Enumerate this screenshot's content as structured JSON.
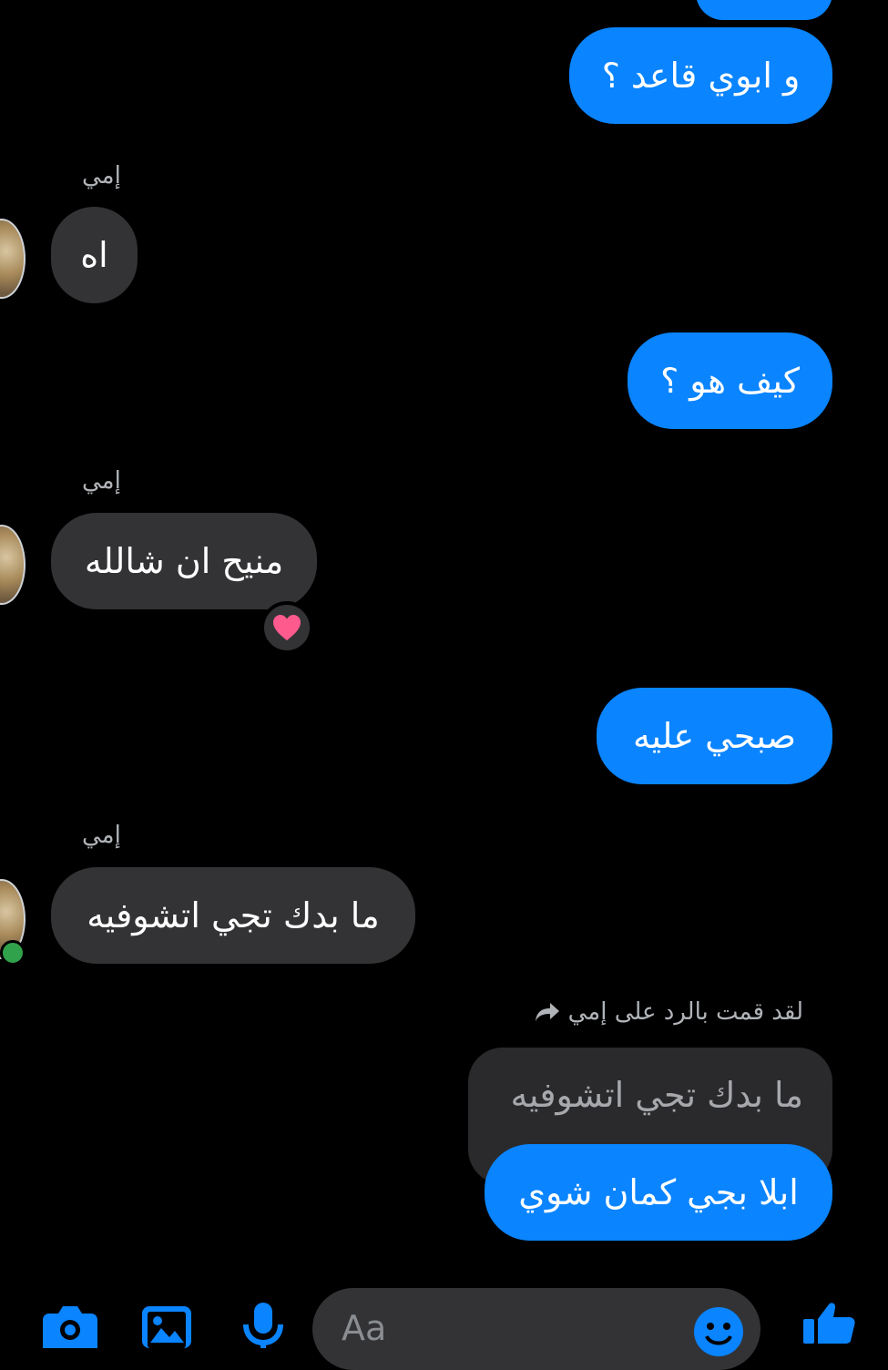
{
  "thread": {
    "sender_name": "إمي",
    "messages": [
      {
        "from": "me",
        "text": "و ابوي قاعد ؟"
      },
      {
        "from": "them",
        "text": "اه"
      },
      {
        "from": "me",
        "text": "كيف هو ؟"
      },
      {
        "from": "them",
        "text": "منيح ان شالله",
        "reaction": "pink-heart-icon"
      },
      {
        "from": "me",
        "text": "صبحي عليه"
      },
      {
        "from": "them",
        "text": "ما بدك تجي اتشوفيه"
      },
      {
        "from": "me",
        "text": "ابلا بجي كمان شوي"
      }
    ],
    "reply": {
      "note": "لقد قمت بالرد على إمي",
      "quoted_text": "ما بدك تجي اتشوفيه"
    }
  },
  "composer": {
    "placeholder": "Aa",
    "icons": [
      "camera-icon",
      "image-icon",
      "microphone-icon",
      "emoji-icon",
      "like-thumb-icon"
    ]
  },
  "colors": {
    "outgoing_bubble": "#0a84ff",
    "incoming_bubble": "#333335",
    "background": "#000000",
    "icon_accent": "#0a84ff",
    "online": "#31a24c"
  }
}
